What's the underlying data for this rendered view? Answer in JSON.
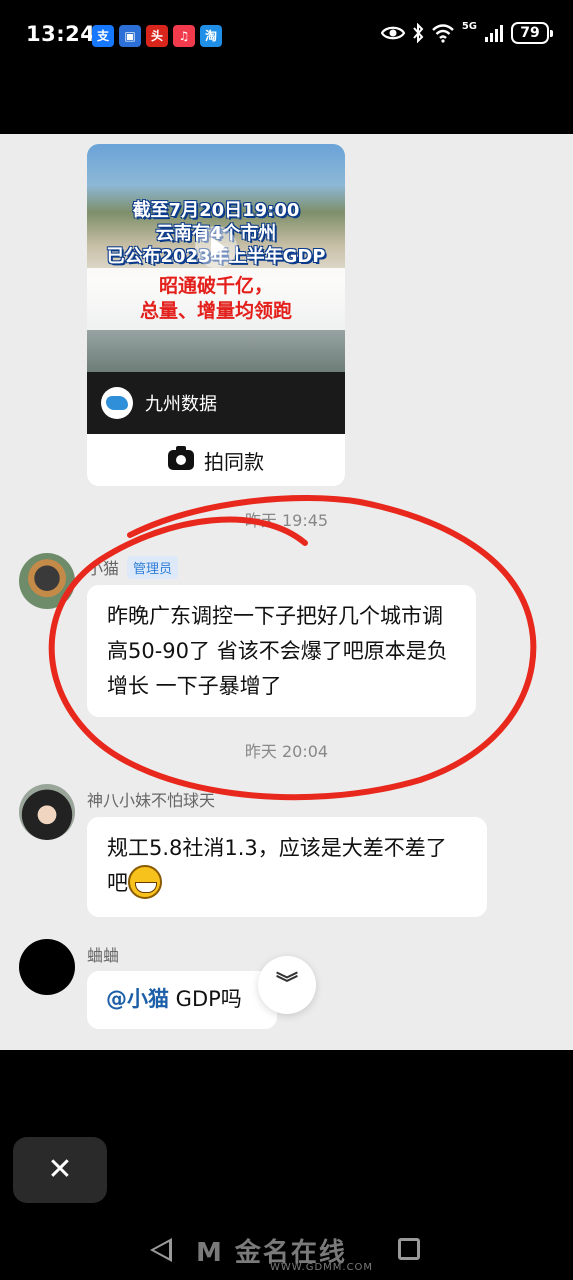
{
  "status_bar": {
    "time": "13:24",
    "apps": [
      {
        "icon": "alipay-icon",
        "glyph": "支",
        "color": "#1677ff"
      },
      {
        "icon": "mobile-bank-icon",
        "glyph": "▣",
        "color": "#2c6fd6"
      },
      {
        "icon": "news-app-icon",
        "glyph": "头",
        "color": "#d9261c"
      },
      {
        "icon": "music-app-icon",
        "glyph": "♫",
        "color": "#f23a4d"
      },
      {
        "icon": "shopping-app-icon",
        "glyph": "淘",
        "color": "#1f8fe8"
      }
    ],
    "network": "5G",
    "battery": "79"
  },
  "shared_card": {
    "image_line1": "截至7月20日19:00",
    "image_line2": "云南有4个市州",
    "image_line3": "已公布2023年上半年GDP",
    "image_red1": "昭通破千亿，",
    "image_red2": "总量、增量均领跑",
    "source_name": "九州数据",
    "action_label": "拍同款"
  },
  "messages": {
    "timestamp1": "昨天 19:45",
    "m1_sender": "小猫",
    "m1_badge": "管理员",
    "m1_text": "昨晚广东调控一下子把好几个城市调高50-90了  省该不会爆了吧原本是负增长  一下子暴增了",
    "timestamp2": "昨天 20:04",
    "m2_sender": "神八小妹不怕球天",
    "m2_text": "规工5.8社消1.3，应该是大差不差了吧",
    "m3_sender": "蛐蛐",
    "m3_mention": "@小猫",
    "m3_text": " GDP吗"
  },
  "overlay": {
    "close_glyph": "✕",
    "scroll_glyph": "︾"
  },
  "watermark": {
    "text": "M 金名在线",
    "url": "WWW.GDMM.COM"
  },
  "colors": {
    "chat_bg": "#ececec",
    "annotation_red": "#e8281c",
    "admin_badge": "#2f7fd8"
  }
}
